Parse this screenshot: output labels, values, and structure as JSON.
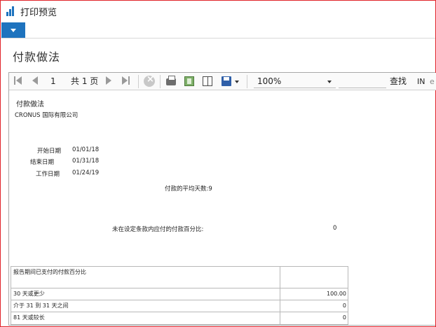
{
  "window": {
    "title": "打印预览"
  },
  "page": {
    "title": "付款做法"
  },
  "toolbar": {
    "page_number": "1",
    "page_total": "共 1 页",
    "zoom": "100%",
    "find_label": "查找",
    "next_label": "IN",
    "next_label2": "e"
  },
  "report": {
    "title": "付款做法",
    "company": "CRONUS 国际有限公司",
    "fields": [
      {
        "label": "开始日期",
        "value": "01/01/18"
      },
      {
        "label": "结束日期",
        "value": "01/31/18"
      },
      {
        "label": "工作日期",
        "value": "01/24/19"
      }
    ],
    "avg_days": "付款的平均天数:9",
    "not_in_terms_label": "未在设定条款内应付的付款百分比:",
    "not_in_terms_value": "0",
    "table": {
      "header": "报告期间已支付的付款百分比",
      "rows": [
        {
          "label": "30 天或更少",
          "value": "100.00"
        },
        {
          "label": "介于 31 到 31 天之间",
          "value": "0"
        },
        {
          "label": "81 天或较长",
          "value": "0"
        }
      ]
    }
  },
  "colors": {
    "accent": "#1e73be",
    "frame": "#e0232a"
  }
}
